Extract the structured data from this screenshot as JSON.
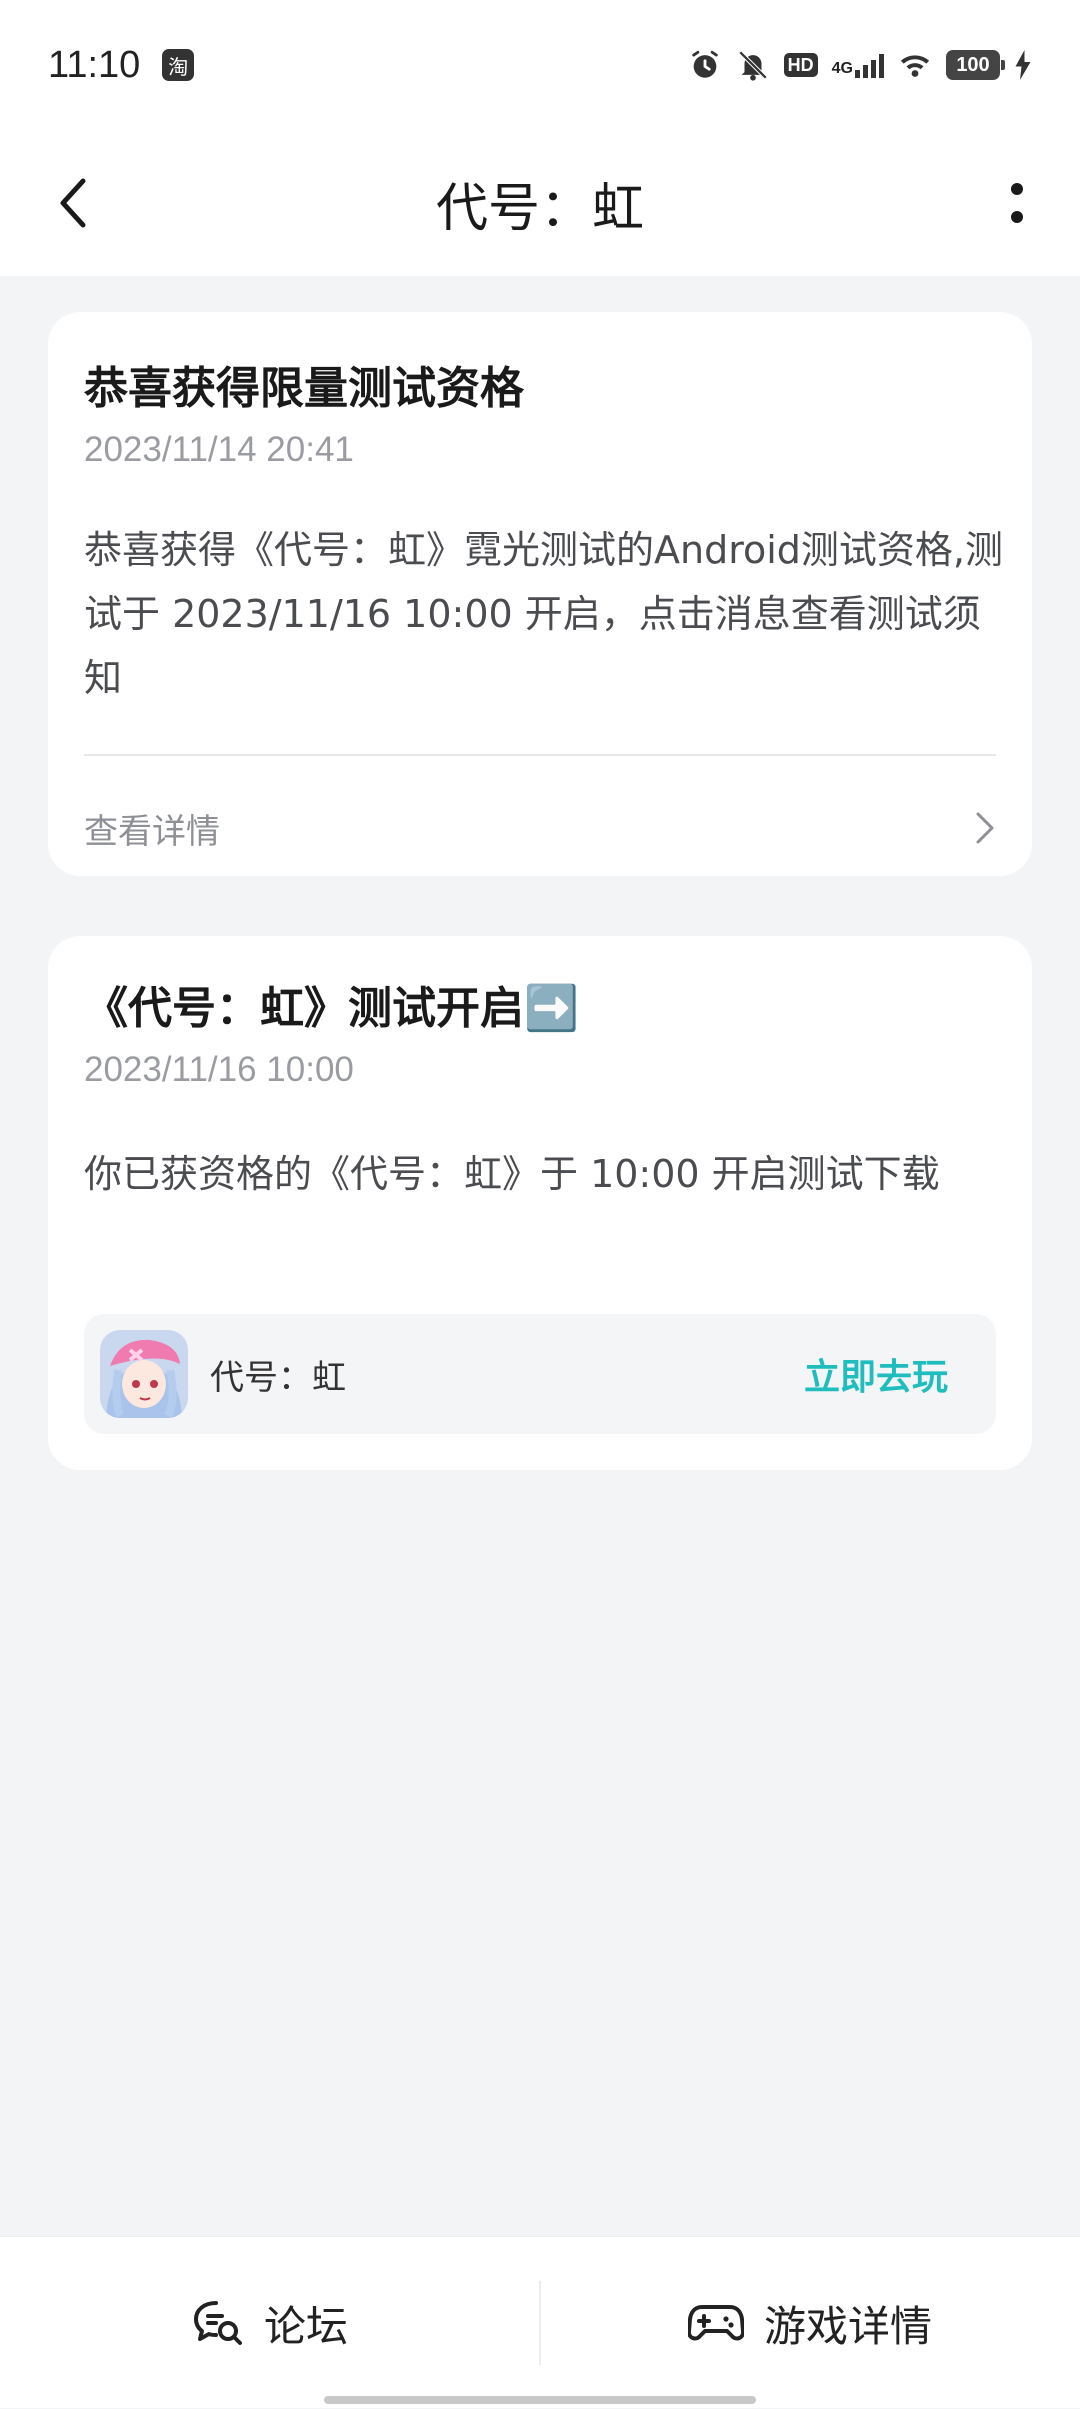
{
  "status_bar": {
    "time": "11:10",
    "app_badge": "淘",
    "hd": "HD",
    "network": "4G",
    "battery": "100"
  },
  "header": {
    "title": "代号：虹"
  },
  "messages": [
    {
      "title": "恭喜获得限量测试资格",
      "time": "2023/11/14 20:41",
      "body": "恭喜获得《代号：虹》霓光测试的Android测试资格,测试于 2023/11/16 10:00 开启，点击消息查看测试须知",
      "detail_label": "查看详情"
    },
    {
      "title": "《代号：虹》测试开启➡️",
      "time": "2023/11/16 10:00",
      "body": "你已获资格的《代号：虹》于 10:00 开启测试下载",
      "game_name": "代号：虹",
      "play_label": "立即去玩"
    }
  ],
  "bottom_tabs": {
    "forum": "论坛",
    "game_details": "游戏详情"
  },
  "colors": {
    "accent": "#1fbdbd",
    "background": "#f3f4f6"
  }
}
